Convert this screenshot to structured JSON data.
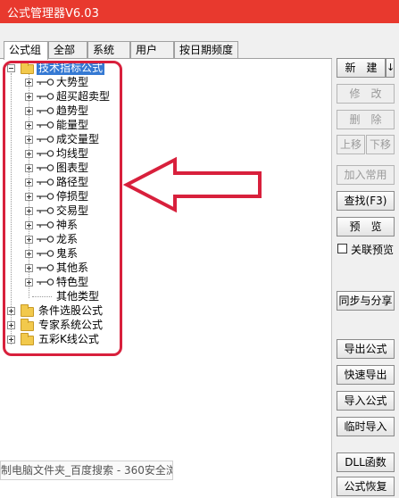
{
  "window": {
    "title": "公式管理器V6.03"
  },
  "tabs": [
    "公式组",
    "全部",
    "系统",
    "用户",
    "按日期频度"
  ],
  "tree": {
    "root": "技术指标公式",
    "children": [
      "大势型",
      "超买超卖型",
      "趋势型",
      "能量型",
      "成交量型",
      "均线型",
      "图表型",
      "路径型",
      "停损型",
      "交易型",
      "神系",
      "龙系",
      "鬼系",
      "其他系",
      "特色型",
      "其他类型"
    ],
    "siblings": [
      "条件选股公式",
      "专家系统公式",
      "五彩K线公式"
    ]
  },
  "buttons": {
    "new": "新　建",
    "new_dropdown": "↓",
    "modify": "修　改",
    "delete": "删　除",
    "move_up": "上移",
    "move_down": "下移",
    "add_common": "加入常用",
    "find": "查找(F3)",
    "preview": "预　览",
    "linked_preview": "关联预览",
    "sync_share": "同步与分享",
    "export": "导出公式",
    "quick_export": "快速导出",
    "import": "导入公式",
    "temp_import": "临时导入",
    "dll": "DLL函数",
    "restore": "公式恢复"
  },
  "tooltip": "制电脑文件夹_百度搜索 - 360安全浏",
  "colors": {
    "titlebar": "#e8392e",
    "selected": "#3579d3",
    "annotation": "#d8203c"
  }
}
